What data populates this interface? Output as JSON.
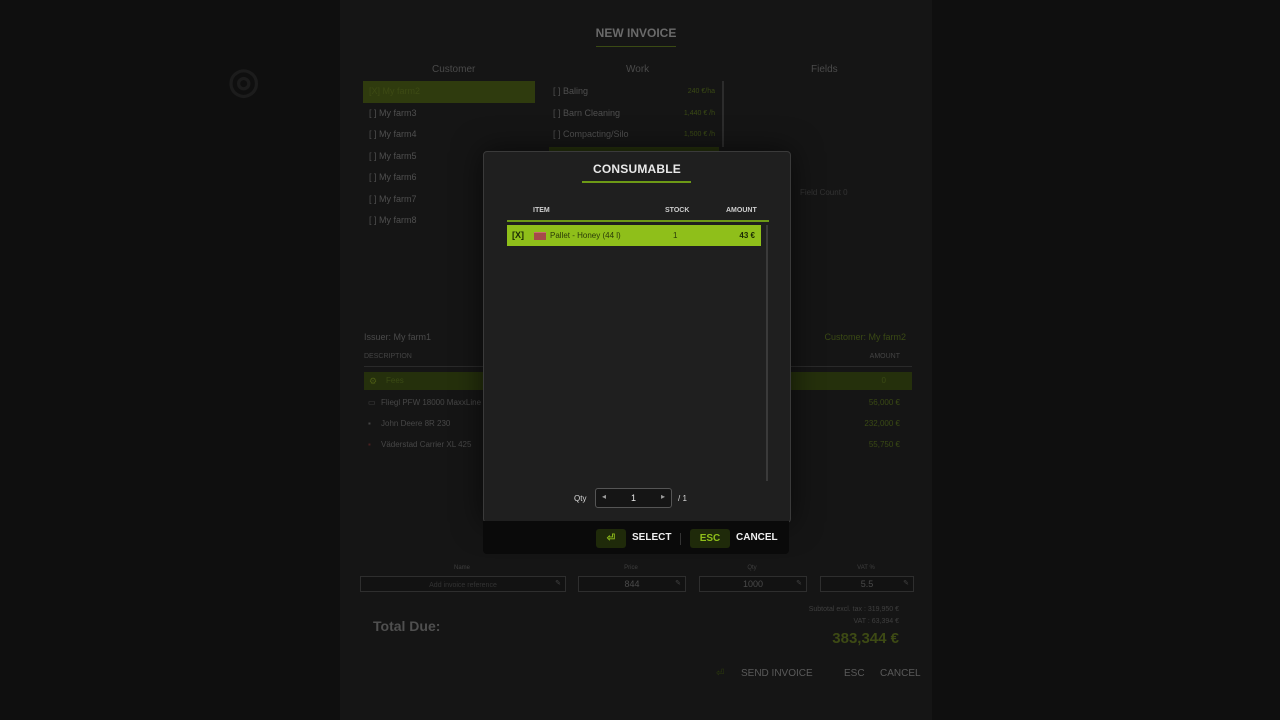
{
  "background": {
    "title": "NEW INVOICE",
    "columns": {
      "customer": "Customer",
      "work": "Work",
      "fields": "Fields"
    },
    "customers": [
      {
        "label": "[X]  My farm2",
        "selected": true
      },
      {
        "label": "[  ]  My farm3"
      },
      {
        "label": "[  ]  My farm4"
      },
      {
        "label": "[  ]  My farm5"
      },
      {
        "label": "[  ]  My farm6"
      },
      {
        "label": "[  ]  My farm7"
      },
      {
        "label": "[  ]  My farm8"
      }
    ],
    "work_items": [
      {
        "label": "[  ]  Baling",
        "price": "240 €/ha"
      },
      {
        "label": "[  ]  Barn Cleaning",
        "price": "1,440 € /h"
      },
      {
        "label": "[  ]  Compacting/Silo",
        "price": "1,500 € /h"
      }
    ],
    "field_hint": "Field Count 0",
    "issue": "Issuer: My farm1",
    "customer_right": "Customer: My farm2",
    "desc_header": "DESCRIPTION",
    "amount_header": "AMOUNT",
    "selected_desc": "Fees",
    "selected_desc_amt": "0",
    "desc_rows": [
      {
        "icon": "truck-icon",
        "label": "Fliegl PFW 18000 MaxxLine",
        "amount": "56,000 €"
      },
      {
        "icon": "tractor-icon",
        "label": "John Deere 8R 230",
        "amount": "232,000 €"
      },
      {
        "icon": "seeder-icon",
        "label": "Väderstad Carrier XL 425",
        "amount": "55,750 €"
      }
    ],
    "inputs": {
      "name_label": "Name",
      "name_placeholder": "Add invoice reference",
      "price_label": "Price",
      "price_value": "844",
      "qty_label": "Qty",
      "qty_value": "1000",
      "vat_label": "VAT %",
      "vat_value": "5.5"
    },
    "total_label": "Total Due:",
    "subtotal": "Subtotal excl. tax : 319,950 €",
    "vat": "VAT : 63,394 €",
    "grand_total": "383,344 €",
    "footer": {
      "send": "SEND INVOICE",
      "esc": "ESC",
      "cancel": "CANCEL"
    }
  },
  "modal": {
    "title": "CONSUMABLE",
    "headers": {
      "item": "ITEM",
      "stock": "STOCK",
      "amount": "AMOUNT"
    },
    "rows": [
      {
        "check": "[X]",
        "icon": "pallet-icon",
        "name": "Pallet - Honey (44 l)",
        "stock": "1",
        "amount": "43 €",
        "selected": true
      }
    ],
    "qty": {
      "label": "Qty",
      "value": "1",
      "max": "/ 1"
    },
    "buttons": {
      "select_key": "⏎",
      "select": "SELECT",
      "cancel_key": "ESC",
      "cancel": "CANCEL"
    }
  },
  "colors": {
    "accent": "#8fbf1a",
    "accent_line": "#6d9a16",
    "modal_bg": "#1f1f1f",
    "page_bg": "#0f0f0f"
  }
}
